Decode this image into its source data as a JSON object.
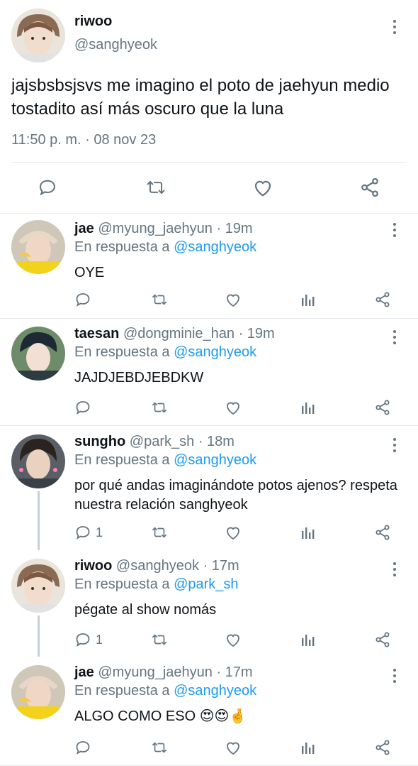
{
  "main_tweet": {
    "name": "riwoo",
    "handle": "@sanghyeok",
    "text": "jajsbsbsjsvs me imagino el poto de jaehyun medio tostadito así más oscuro que la luna",
    "timestamp": "11:50 p. m. · 08 nov 23",
    "actions": [
      "reply-icon",
      "retweet-icon",
      "like-icon",
      "share-icon"
    ]
  },
  "replies": [
    {
      "name": "jae",
      "handle": "@myung_jaehyun",
      "time": "· 19m",
      "in_reply_label": "En respuesta a",
      "in_reply_to": "@sanghyeok",
      "text": "OYE",
      "reply_count": ""
    },
    {
      "name": "taesan",
      "handle": "@dongminie_han",
      "time": "· 19m",
      "in_reply_label": "En respuesta a",
      "in_reply_to": "@sanghyeok",
      "text": "JAJDJEBDJEBDKW",
      "reply_count": ""
    },
    {
      "name": "sungho",
      "handle": "@park_sh",
      "time": "· 18m",
      "in_reply_label": "En respuesta a",
      "in_reply_to": "@sanghyeok",
      "text": "por qué andas imaginándote potos ajenos? respeta nuestra relación sanghyeok",
      "reply_count": "1"
    },
    {
      "name": "riwoo",
      "handle": "@sanghyeok",
      "time": "· 17m",
      "in_reply_label": "En respuesta a",
      "in_reply_to": "@park_sh",
      "text": "pégate al show nomás",
      "reply_count": "1"
    },
    {
      "name": "jae",
      "handle": "@myung_jaehyun",
      "time": "· 17m",
      "in_reply_label": "En respuesta a",
      "in_reply_to": "@sanghyeok",
      "text": "ALGO COMO ESO 😍😍🤞",
      "reply_count": ""
    }
  ],
  "colors": {
    "accent": "#1d9bf0",
    "muted": "#66757f",
    "text": "#0f1419",
    "border": "#e6e9ec"
  }
}
